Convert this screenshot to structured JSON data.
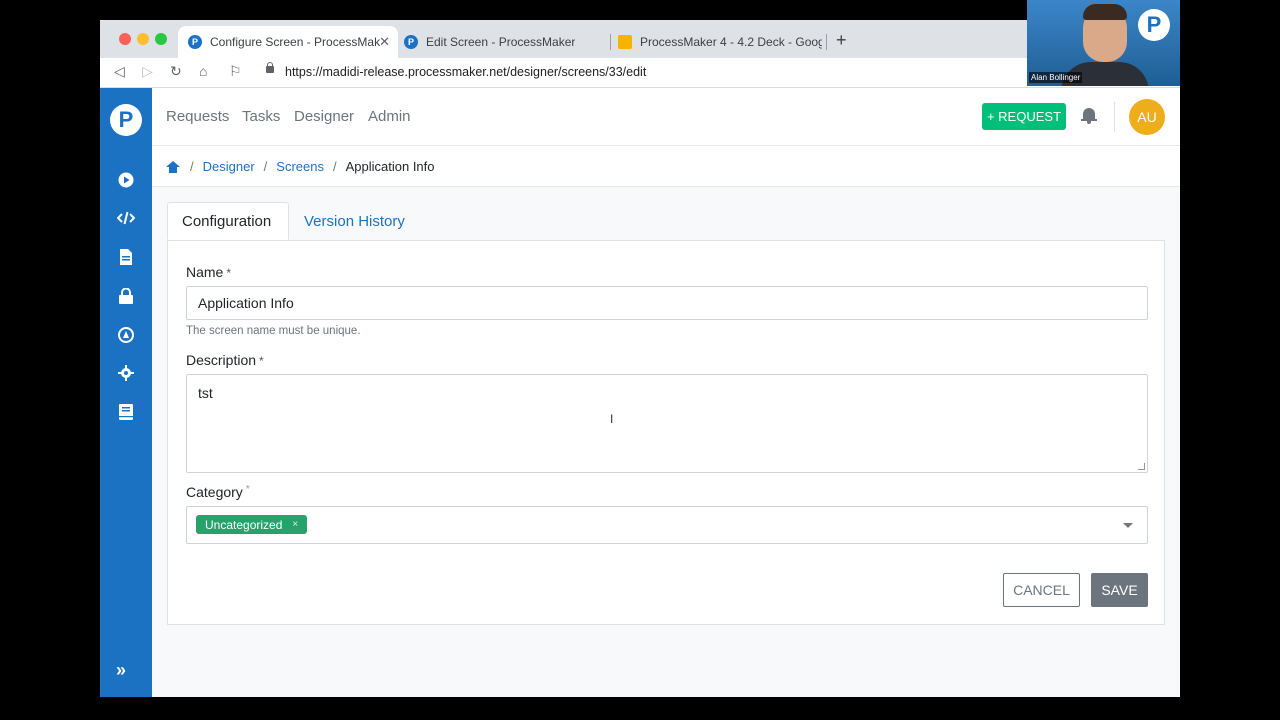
{
  "browser": {
    "tabs": [
      {
        "label": "Configure Screen - ProcessMak",
        "active": true
      },
      {
        "label": "Edit Screen - ProcessMaker",
        "active": false
      },
      {
        "label": "ProcessMaker 4 - 4.2 Deck - Goog",
        "active": false
      }
    ],
    "new_tab": "+",
    "url": "https://madidi-release.processmaker.net/designer/screens/33/edit"
  },
  "nav": {
    "links": [
      "Requests",
      "Tasks",
      "Designer",
      "Admin"
    ],
    "request_button": "+ REQUEST",
    "avatar_initials": "AU"
  },
  "breadcrumb": {
    "items": [
      "Designer",
      "Screens"
    ],
    "current": "Application Info",
    "separator": "/"
  },
  "tabs": {
    "configuration": "Configuration",
    "version_history": "Version History"
  },
  "form": {
    "name_label": "Name",
    "name_value": "Application Info",
    "name_help": "The screen name must be unique.",
    "description_label": "Description",
    "description_value": "tst",
    "category_label": "Category",
    "category_chip": "Uncategorized",
    "required_mark": "*",
    "chip_remove": "×",
    "cancel_label": "CANCEL",
    "save_label": "SAVE"
  },
  "webcam": {
    "name": "Alan Bollinger"
  },
  "colors": {
    "brand_blue": "#1c72c2",
    "request_green": "#00bf7a",
    "chip_green": "#28a26b",
    "avatar_orange": "#f0ad1b",
    "save_gray": "#6c757d"
  }
}
